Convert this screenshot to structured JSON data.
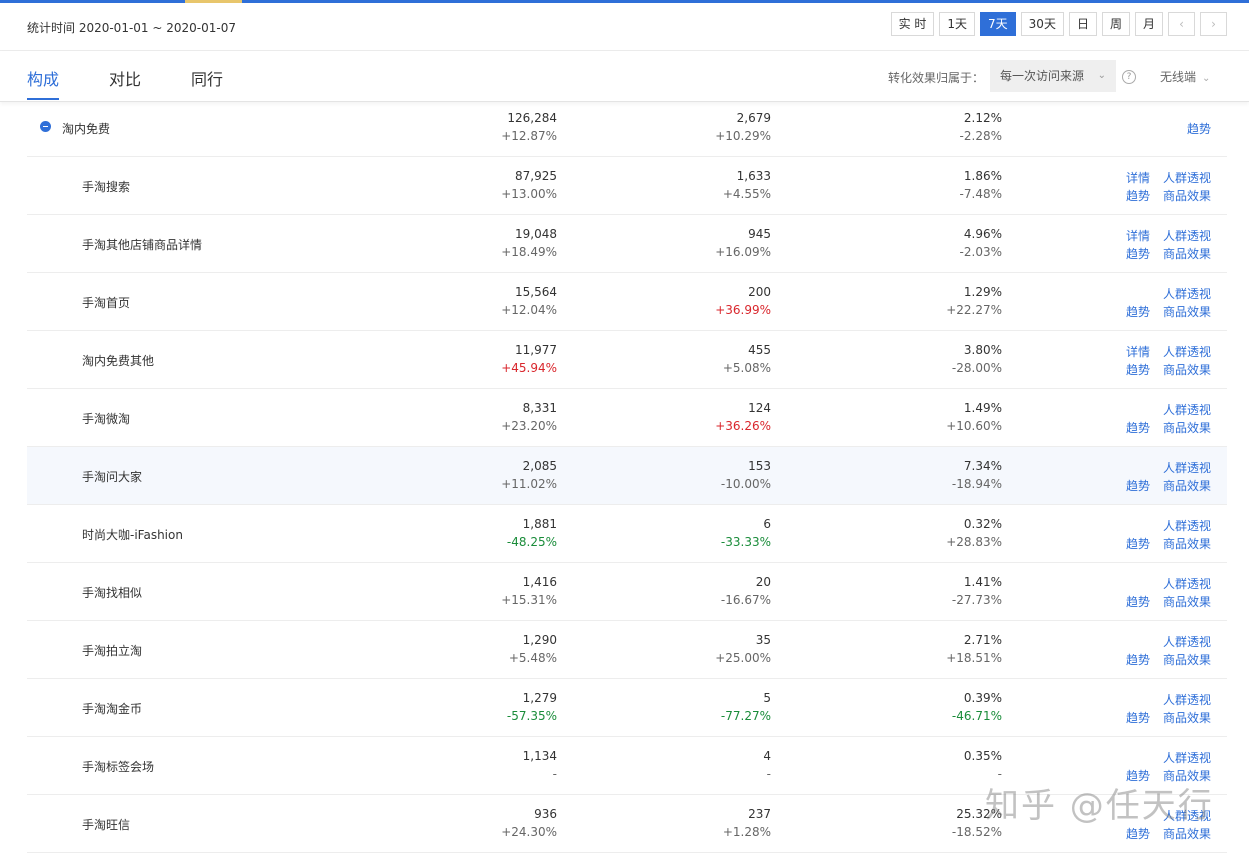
{
  "header": {
    "stat_time": "统计时间 2020-01-01 ~ 2020-01-07",
    "ranges": [
      "实 时",
      "1天",
      "7天",
      "30天",
      "日",
      "周",
      "月"
    ],
    "active_range": "7天",
    "prev_icon": "‹",
    "next_icon": "›"
  },
  "tabs": {
    "items": [
      "构成",
      "对比",
      "同行"
    ],
    "active": "构成",
    "attr_label": "转化效果归属于：",
    "attr_value": "每一次访问来源",
    "help_icon": "?",
    "device": "无线端"
  },
  "rows": [
    {
      "name": "淘内免费",
      "v1": "126,284",
      "c1": "+12.87%",
      "v2": "2,679",
      "c2": "+10.29%",
      "v3": "2.12%",
      "c3": "-2.28%",
      "parent": true,
      "links": [
        "趋势"
      ]
    },
    {
      "name": "手淘搜索",
      "v1": "87,925",
      "c1": "+13.00%",
      "v2": "1,633",
      "c2": "+4.55%",
      "v3": "1.86%",
      "c3": "-7.48%",
      "links": [
        "详情",
        "人群透视",
        "趋势",
        "商品效果"
      ]
    },
    {
      "name": "手淘其他店铺商品详情",
      "v1": "19,048",
      "c1": "+18.49%",
      "v2": "945",
      "c2": "+16.09%",
      "v3": "4.96%",
      "c3": "-2.03%",
      "links": [
        "详情",
        "人群透视",
        "趋势",
        "商品效果"
      ]
    },
    {
      "name": "手淘首页",
      "v1": "15,564",
      "c1": "+12.04%",
      "v2": "200",
      "c2": "+36.99%",
      "c2s": "up",
      "v3": "1.29%",
      "c3": "+22.27%",
      "links": [
        "人群透视",
        "趋势",
        "商品效果"
      ]
    },
    {
      "name": "淘内免费其他",
      "v1": "11,977",
      "c1": "+45.94%",
      "c1s": "up",
      "v2": "455",
      "c2": "+5.08%",
      "v3": "3.80%",
      "c3": "-28.00%",
      "links": [
        "详情",
        "人群透视",
        "趋势",
        "商品效果"
      ]
    },
    {
      "name": "手淘微淘",
      "v1": "8,331",
      "c1": "+23.20%",
      "v2": "124",
      "c2": "+36.26%",
      "c2s": "up",
      "v3": "1.49%",
      "c3": "+10.60%",
      "links": [
        "人群透视",
        "趋势",
        "商品效果"
      ]
    },
    {
      "name": "手淘问大家",
      "v1": "2,085",
      "c1": "+11.02%",
      "v2": "153",
      "c2": "-10.00%",
      "v3": "7.34%",
      "c3": "-18.94%",
      "highlight": true,
      "links": [
        "人群透视",
        "趋势",
        "商品效果"
      ]
    },
    {
      "name": "时尚大咖-iFashion",
      "v1": "1,881",
      "c1": "-48.25%",
      "c1s": "down",
      "v2": "6",
      "c2": "-33.33%",
      "c2s": "down",
      "v3": "0.32%",
      "c3": "+28.83%",
      "links": [
        "人群透视",
        "趋势",
        "商品效果"
      ]
    },
    {
      "name": "手淘找相似",
      "v1": "1,416",
      "c1": "+15.31%",
      "v2": "20",
      "c2": "-16.67%",
      "v3": "1.41%",
      "c3": "-27.73%",
      "links": [
        "人群透视",
        "趋势",
        "商品效果"
      ]
    },
    {
      "name": "手淘拍立淘",
      "v1": "1,290",
      "c1": "+5.48%",
      "v2": "35",
      "c2": "+25.00%",
      "v3": "2.71%",
      "c3": "+18.51%",
      "links": [
        "人群透视",
        "趋势",
        "商品效果"
      ]
    },
    {
      "name": "手淘淘金币",
      "v1": "1,279",
      "c1": "-57.35%",
      "c1s": "down",
      "v2": "5",
      "c2": "-77.27%",
      "c2s": "down",
      "v3": "0.39%",
      "c3": "-46.71%",
      "c3s": "down",
      "links": [
        "人群透视",
        "趋势",
        "商品效果"
      ]
    },
    {
      "name": "手淘标签会场",
      "v1": "1,134",
      "c1": "-",
      "v2": "4",
      "c2": "-",
      "v3": "0.35%",
      "c3": "-",
      "links": [
        "人群透视",
        "趋势",
        "商品效果"
      ]
    },
    {
      "name": "手淘旺信",
      "v1": "936",
      "c1": "+24.30%",
      "v2": "237",
      "c2": "+1.28%",
      "v3": "25.32%",
      "c3": "-18.52%",
      "links": [
        "人群透视",
        "趋势",
        "商品效果"
      ]
    }
  ],
  "watermark": "知乎 @任天行"
}
